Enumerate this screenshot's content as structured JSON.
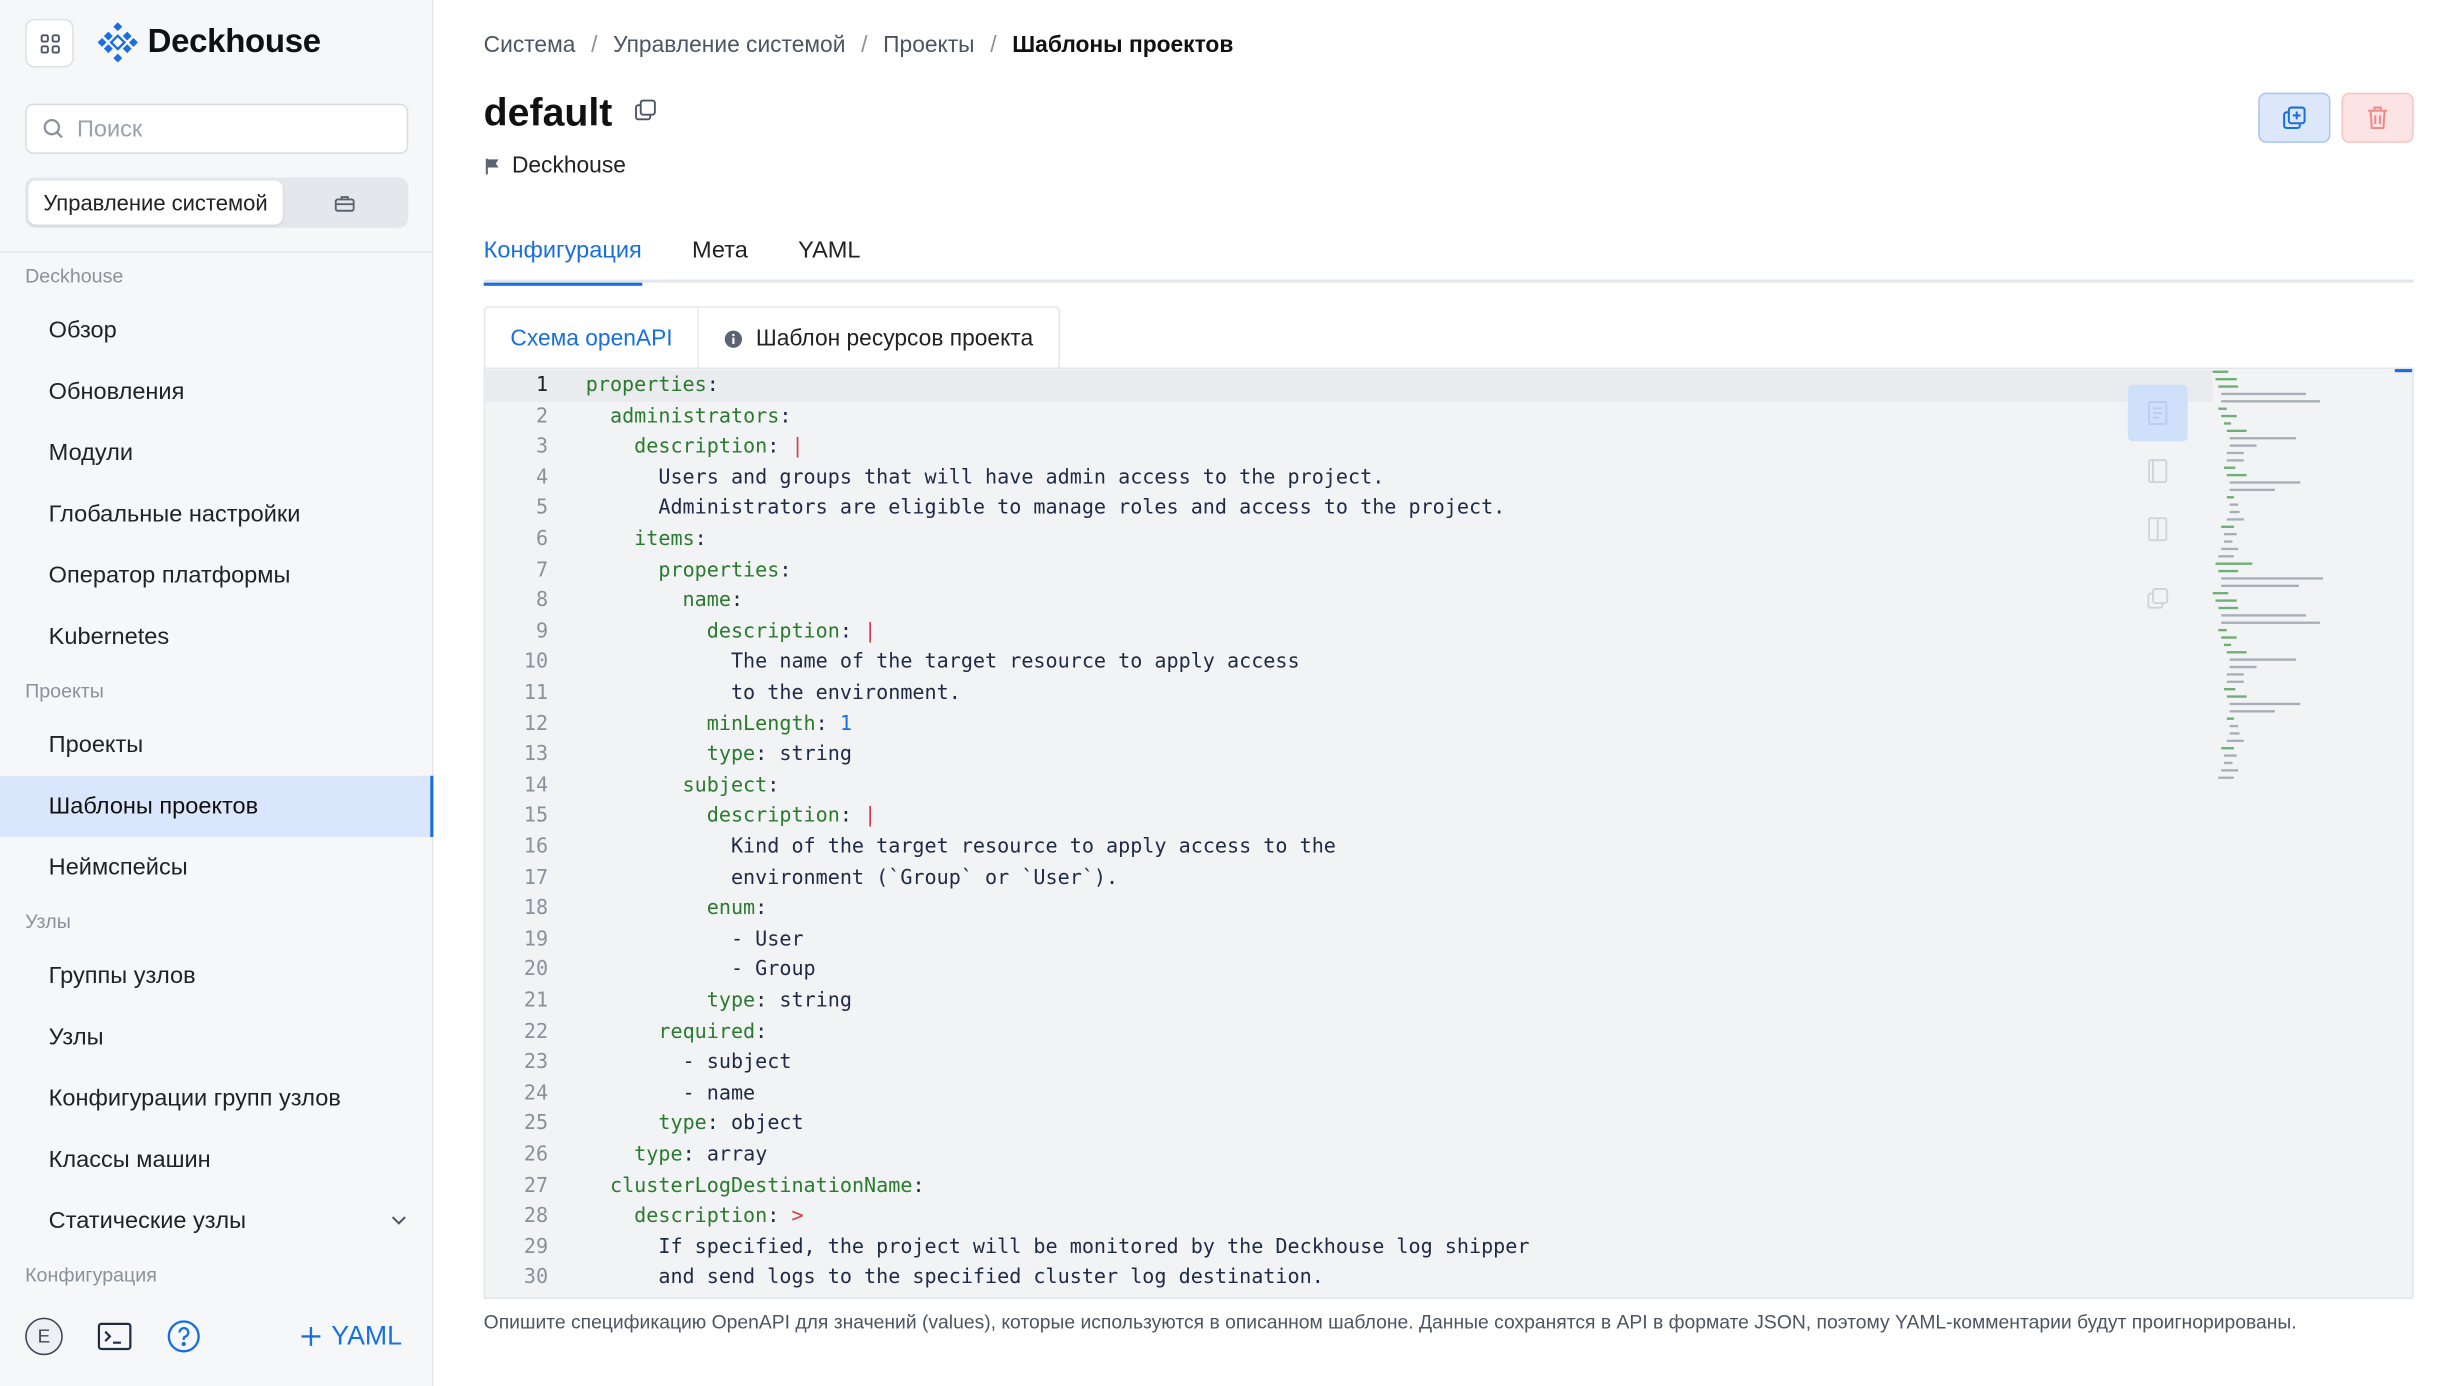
{
  "app": {
    "name": "Deckhouse"
  },
  "search": {
    "placeholder": "Поиск"
  },
  "mode_switch": {
    "active_label": "Управление системой"
  },
  "nav": [
    {
      "type": "section",
      "label": "Deckhouse"
    },
    {
      "type": "item",
      "label": "Обзор"
    },
    {
      "type": "item",
      "label": "Обновления"
    },
    {
      "type": "item",
      "label": "Модули"
    },
    {
      "type": "item",
      "label": "Глобальные настройки"
    },
    {
      "type": "item",
      "label": "Оператор платформы"
    },
    {
      "type": "item",
      "label": "Kubernetes"
    },
    {
      "type": "section",
      "label": "Проекты"
    },
    {
      "type": "item",
      "label": "Проекты"
    },
    {
      "type": "item",
      "label": "Шаблоны проектов",
      "active": true
    },
    {
      "type": "item",
      "label": "Неймспейсы"
    },
    {
      "type": "section",
      "label": "Узлы"
    },
    {
      "type": "item",
      "label": "Группы узлов"
    },
    {
      "type": "item",
      "label": "Узлы"
    },
    {
      "type": "item",
      "label": "Конфигурации групп узлов"
    },
    {
      "type": "item",
      "label": "Классы машин"
    },
    {
      "type": "item",
      "label": "Статические узлы",
      "expandable": true
    },
    {
      "type": "section",
      "label": "Конфигурация"
    }
  ],
  "footer": {
    "avatar_letter": "E",
    "add_yaml_label": "YAML"
  },
  "breadcrumb": [
    "Система",
    "Управление системой",
    "Проекты",
    "Шаблоны проектов"
  ],
  "page": {
    "title": "default",
    "subtitle": "Deckhouse"
  },
  "tabs": [
    "Конфигурация",
    "Мета",
    "YAML"
  ],
  "active_tab": 0,
  "subtabs": [
    "Схема openAPI",
    "Шаблон ресурсов проекта"
  ],
  "editor": {
    "current_line": 1,
    "lines": [
      "properties:",
      "  administrators:",
      "    description: |",
      "      Users and groups that will have admin access to the project.",
      "      Administrators are eligible to manage roles and access to the project.",
      "    items:",
      "      properties:",
      "        name:",
      "          description: |",
      "            The name of the target resource to apply access",
      "            to the environment.",
      "          minLength: 1",
      "          type: string",
      "        subject:",
      "          description: |",
      "            Kind of the target resource to apply access to the",
      "            environment (`Group` or `User`).",
      "          enum:",
      "            - User",
      "            - Group",
      "          type: string",
      "      required:",
      "        - subject",
      "        - name",
      "      type: object",
      "    type: array",
      "  clusterLogDestinationName:",
      "    description: >",
      "      If specified, the project will be monitored by the Deckhouse log shipper",
      "      and send logs to the specified cluster log destination."
    ]
  },
  "hint": "Опишите спецификацию OpenAPI для значений (values), которые используются в описанном шаблоне. Данные сохранятся в API в формате JSON, поэтому YAML-комментарии будут проигнорированы.",
  "colors": {
    "accent": "#1a6fe0",
    "active_nav_bg": "#d9e6fb",
    "danger_bg": "#fde4e4"
  }
}
